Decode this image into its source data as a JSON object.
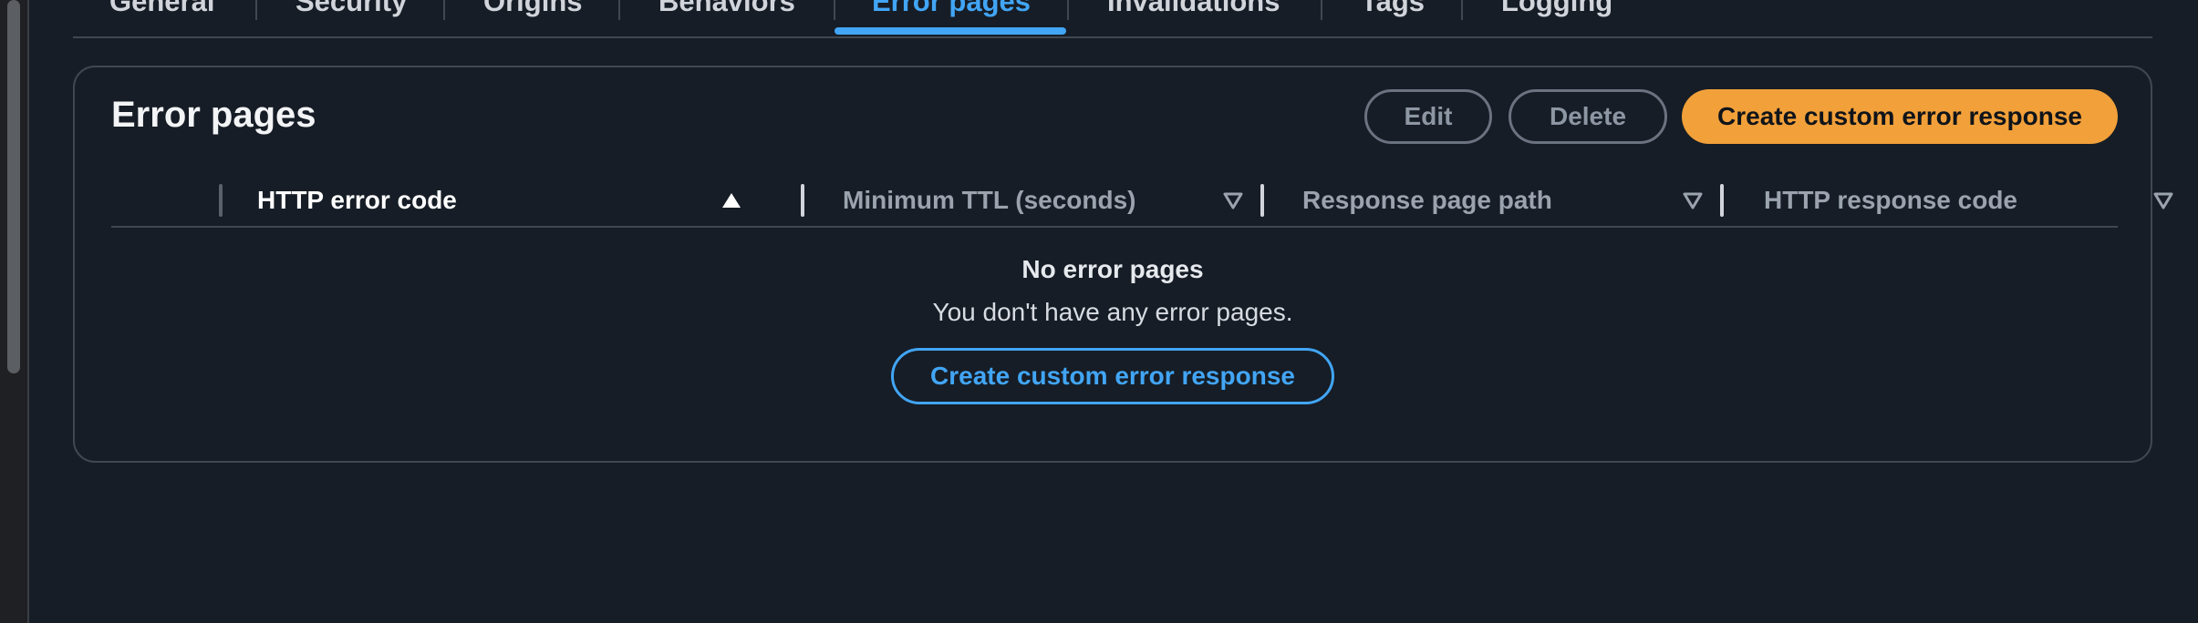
{
  "tabs": [
    {
      "label": "General"
    },
    {
      "label": "Security"
    },
    {
      "label": "Origins"
    },
    {
      "label": "Behaviors"
    },
    {
      "label": "Error pages"
    },
    {
      "label": "Invalidations"
    },
    {
      "label": "Tags"
    },
    {
      "label": "Logging"
    }
  ],
  "active_tab": "Error pages",
  "panel": {
    "title": "Error pages",
    "edit_label": "Edit",
    "delete_label": "Delete",
    "create_label": "Create custom error response"
  },
  "table": {
    "columns": [
      {
        "label": "HTTP error code",
        "sort": "ascending",
        "icon": "sort-ascending-icon"
      },
      {
        "label": "Minimum TTL (seconds)",
        "sort": "none",
        "icon": "sort-descending-icon"
      },
      {
        "label": "Response page path",
        "sort": "none",
        "icon": "sort-descending-icon"
      },
      {
        "label": "HTTP response code",
        "sort": "none",
        "icon": "sort-descending-icon"
      }
    ],
    "rows": []
  },
  "empty_state": {
    "title": "No error pages",
    "description": "You don't have any error pages.",
    "action_label": "Create custom error response"
  },
  "colors": {
    "background": "#161d26",
    "accent_blue": "#42a5f5",
    "primary_orange": "#f2a03a",
    "border": "#414750"
  }
}
